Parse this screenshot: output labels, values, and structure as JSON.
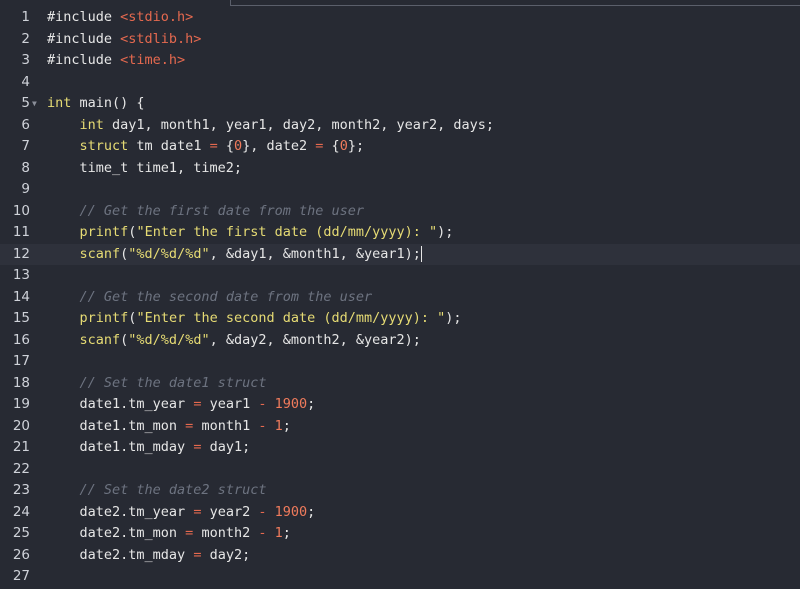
{
  "editor": {
    "active_line": 12,
    "lines": [
      {
        "n": "1",
        "tokens": [
          [
            "inc",
            "#include "
          ],
          [
            "hdr",
            "<stdio.h>"
          ]
        ]
      },
      {
        "n": "2",
        "tokens": [
          [
            "inc",
            "#include "
          ],
          [
            "hdr",
            "<stdlib.h>"
          ]
        ]
      },
      {
        "n": "3",
        "tokens": [
          [
            "inc",
            "#include "
          ],
          [
            "hdr",
            "<time.h>"
          ]
        ]
      },
      {
        "n": "4",
        "tokens": []
      },
      {
        "n": "5",
        "fold": true,
        "tokens": [
          [
            "kw",
            "int"
          ],
          [
            "id",
            " main() {"
          ]
        ]
      },
      {
        "n": "6",
        "tokens": [
          [
            "id",
            "    "
          ],
          [
            "kw",
            "int"
          ],
          [
            "id",
            " day1, month1, year1, day2, month2, year2, days;"
          ]
        ]
      },
      {
        "n": "7",
        "tokens": [
          [
            "id",
            "    "
          ],
          [
            "kw",
            "struct"
          ],
          [
            "id",
            " tm date1 "
          ],
          [
            "op",
            "="
          ],
          [
            "id",
            " {"
          ],
          [
            "num",
            "0"
          ],
          [
            "id",
            "}, date2 "
          ],
          [
            "op",
            "="
          ],
          [
            "id",
            " {"
          ],
          [
            "num",
            "0"
          ],
          [
            "id",
            "};"
          ]
        ]
      },
      {
        "n": "8",
        "tokens": [
          [
            "id",
            "    time_t time1, time2;"
          ]
        ]
      },
      {
        "n": "9",
        "tokens": []
      },
      {
        "n": "10",
        "tokens": [
          [
            "id",
            "    "
          ],
          [
            "cm",
            "// Get the first date from the user"
          ]
        ]
      },
      {
        "n": "11",
        "tokens": [
          [
            "id",
            "    "
          ],
          [
            "fn",
            "printf"
          ],
          [
            "id",
            "("
          ],
          [
            "str",
            "\"Enter the first date (dd/mm/yyyy): \""
          ],
          [
            "id",
            ");"
          ]
        ]
      },
      {
        "n": "12",
        "tokens": [
          [
            "id",
            "    "
          ],
          [
            "fn",
            "scanf"
          ],
          [
            "id",
            "("
          ],
          [
            "str",
            "\"%d/%d/%d\""
          ],
          [
            "id",
            ", &day1, &month1, &year1);"
          ]
        ],
        "caret": true
      },
      {
        "n": "13",
        "tokens": []
      },
      {
        "n": "14",
        "tokens": [
          [
            "id",
            "    "
          ],
          [
            "cm",
            "// Get the second date from the user"
          ]
        ]
      },
      {
        "n": "15",
        "tokens": [
          [
            "id",
            "    "
          ],
          [
            "fn",
            "printf"
          ],
          [
            "id",
            "("
          ],
          [
            "str",
            "\"Enter the second date (dd/mm/yyyy): \""
          ],
          [
            "id",
            ");"
          ]
        ]
      },
      {
        "n": "16",
        "tokens": [
          [
            "id",
            "    "
          ],
          [
            "fn",
            "scanf"
          ],
          [
            "id",
            "("
          ],
          [
            "str",
            "\"%d/%d/%d\""
          ],
          [
            "id",
            ", &day2, &month2, &year2);"
          ]
        ]
      },
      {
        "n": "17",
        "tokens": []
      },
      {
        "n": "18",
        "tokens": [
          [
            "id",
            "    "
          ],
          [
            "cm",
            "// Set the date1 struct"
          ]
        ]
      },
      {
        "n": "19",
        "tokens": [
          [
            "id",
            "    date1.tm_year "
          ],
          [
            "op",
            "="
          ],
          [
            "id",
            " year1 "
          ],
          [
            "op",
            "-"
          ],
          [
            "id",
            " "
          ],
          [
            "num",
            "1900"
          ],
          [
            "id",
            ";"
          ]
        ]
      },
      {
        "n": "20",
        "tokens": [
          [
            "id",
            "    date1.tm_mon "
          ],
          [
            "op",
            "="
          ],
          [
            "id",
            " month1 "
          ],
          [
            "op",
            "-"
          ],
          [
            "id",
            " "
          ],
          [
            "num",
            "1"
          ],
          [
            "id",
            ";"
          ]
        ]
      },
      {
        "n": "21",
        "tokens": [
          [
            "id",
            "    date1.tm_mday "
          ],
          [
            "op",
            "="
          ],
          [
            "id",
            " day1;"
          ]
        ]
      },
      {
        "n": "22",
        "tokens": []
      },
      {
        "n": "23",
        "tokens": [
          [
            "id",
            "    "
          ],
          [
            "cm",
            "// Set the date2 struct"
          ]
        ]
      },
      {
        "n": "24",
        "tokens": [
          [
            "id",
            "    date2.tm_year "
          ],
          [
            "op",
            "="
          ],
          [
            "id",
            " year2 "
          ],
          [
            "op",
            "-"
          ],
          [
            "id",
            " "
          ],
          [
            "num",
            "1900"
          ],
          [
            "id",
            ";"
          ]
        ]
      },
      {
        "n": "25",
        "tokens": [
          [
            "id",
            "    date2.tm_mon "
          ],
          [
            "op",
            "="
          ],
          [
            "id",
            " month2 "
          ],
          [
            "op",
            "-"
          ],
          [
            "id",
            " "
          ],
          [
            "num",
            "1"
          ],
          [
            "id",
            ";"
          ]
        ]
      },
      {
        "n": "26",
        "tokens": [
          [
            "id",
            "    date2.tm_mday "
          ],
          [
            "op",
            "="
          ],
          [
            "id",
            " day2;"
          ]
        ]
      },
      {
        "n": "27",
        "tokens": []
      }
    ]
  },
  "icons": {
    "fold": "chevron-down-icon"
  },
  "colors": {
    "background": "#272a33",
    "active_line": "#2e313b",
    "keyword": "#e6db74",
    "string": "#e6db74",
    "number": "#f07b5c",
    "operator": "#e5694f",
    "comment": "#6d7380",
    "text": "#e6e6e6"
  }
}
